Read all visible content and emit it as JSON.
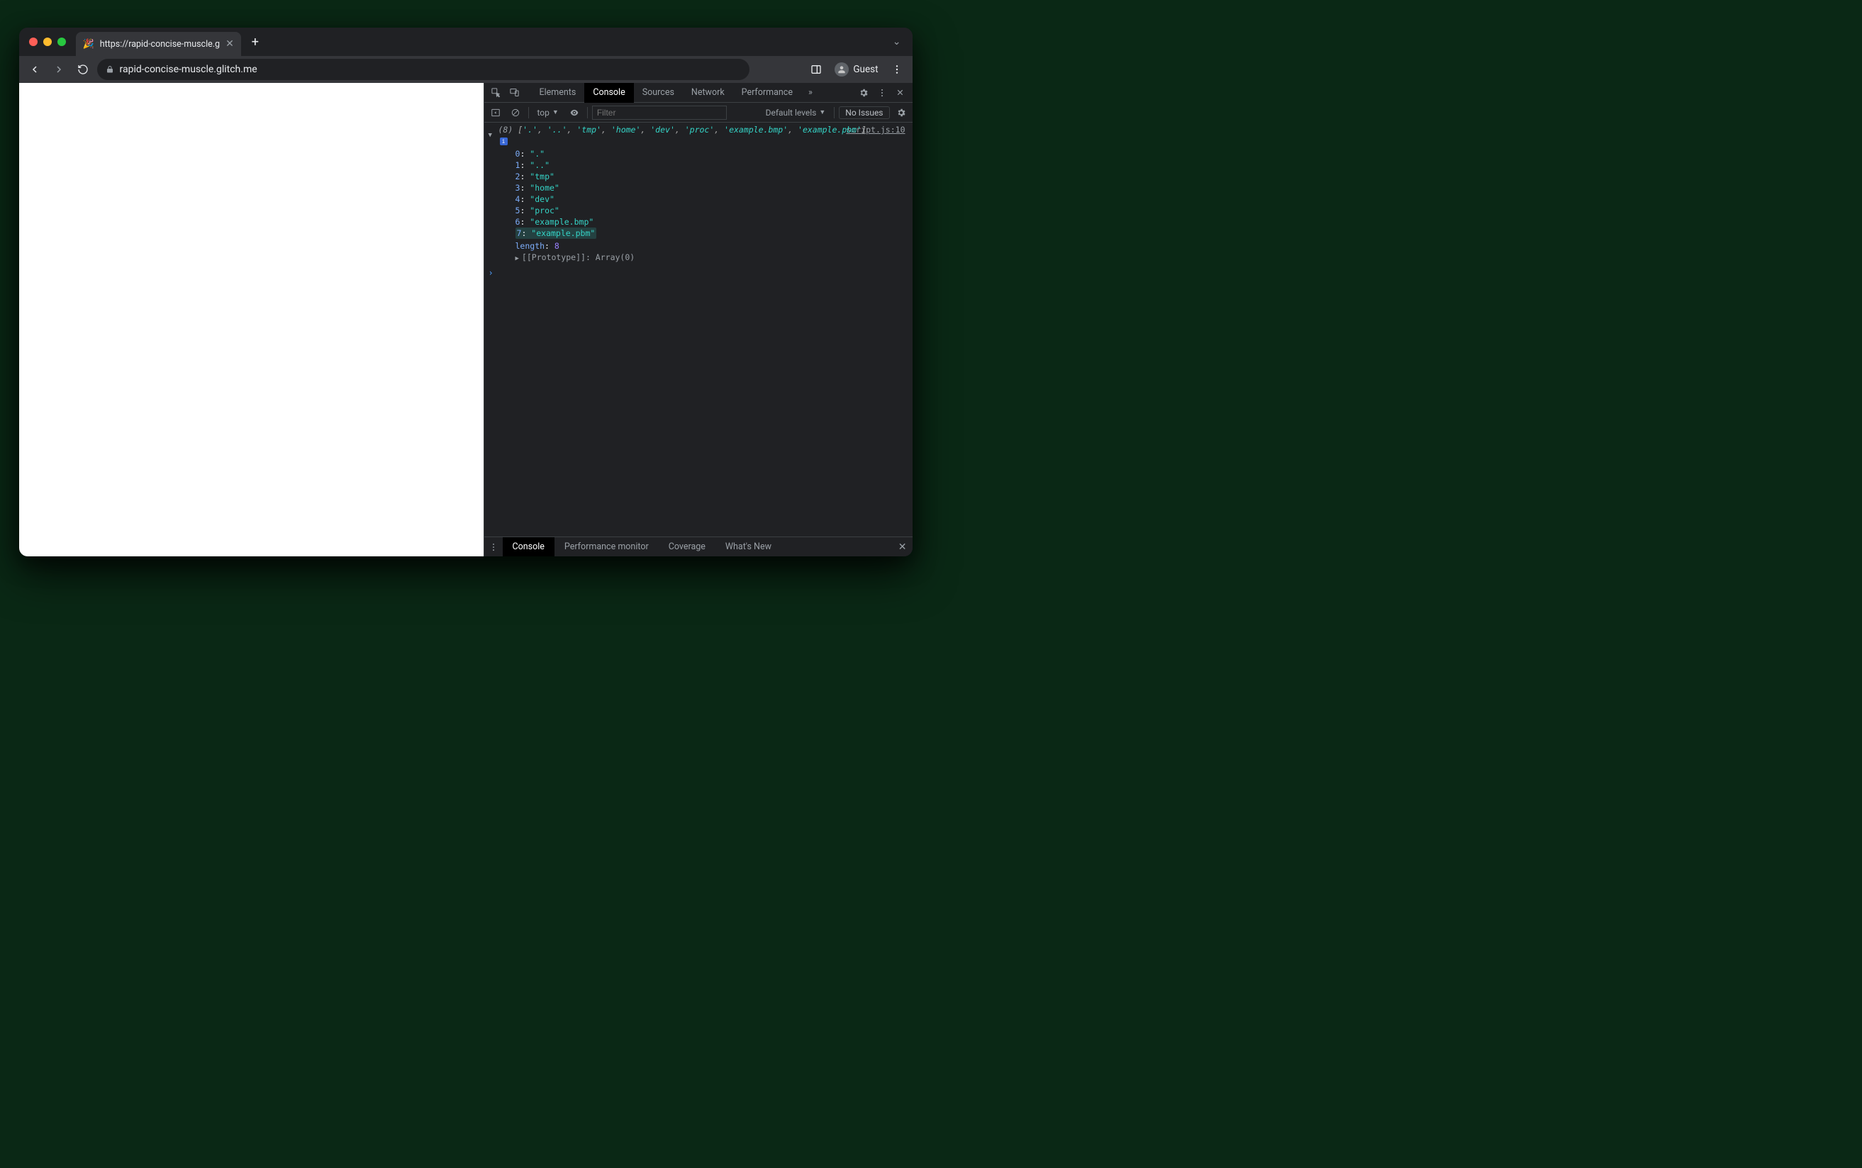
{
  "browser": {
    "tab_title": "https://rapid-concise-muscle.g",
    "tab_favicon": "🎉",
    "url": "rapid-concise-muscle.glitch.me",
    "guest_label": "Guest"
  },
  "devtools": {
    "tabs": [
      "Elements",
      "Console",
      "Sources",
      "Network",
      "Performance"
    ],
    "active_tab": "Console",
    "toolbar": {
      "context": "top",
      "filter_placeholder": "Filter",
      "levels": "Default levels",
      "issues": "No Issues"
    },
    "source_link": "script.js:10",
    "array": {
      "length_label": "(8)",
      "inline": [
        "'.'",
        "'..'",
        "'tmp'",
        "'home'",
        "'dev'",
        "'proc'",
        "'example.bmp'",
        "'example.pbm'"
      ],
      "entries": [
        {
          "k": "0",
          "v": "\".\""
        },
        {
          "k": "1",
          "v": "\"..\""
        },
        {
          "k": "2",
          "v": "\"tmp\""
        },
        {
          "k": "3",
          "v": "\"home\""
        },
        {
          "k": "4",
          "v": "\"dev\""
        },
        {
          "k": "5",
          "v": "\"proc\""
        },
        {
          "k": "6",
          "v": "\"example.bmp\""
        },
        {
          "k": "7",
          "v": "\"example.pbm\""
        }
      ],
      "length_key": "length",
      "length_value": "8",
      "prototype_label": "[[Prototype]]",
      "prototype_value": "Array(0)"
    },
    "drawer": {
      "tabs": [
        "Console",
        "Performance monitor",
        "Coverage",
        "What's New"
      ],
      "active": "Console"
    }
  }
}
